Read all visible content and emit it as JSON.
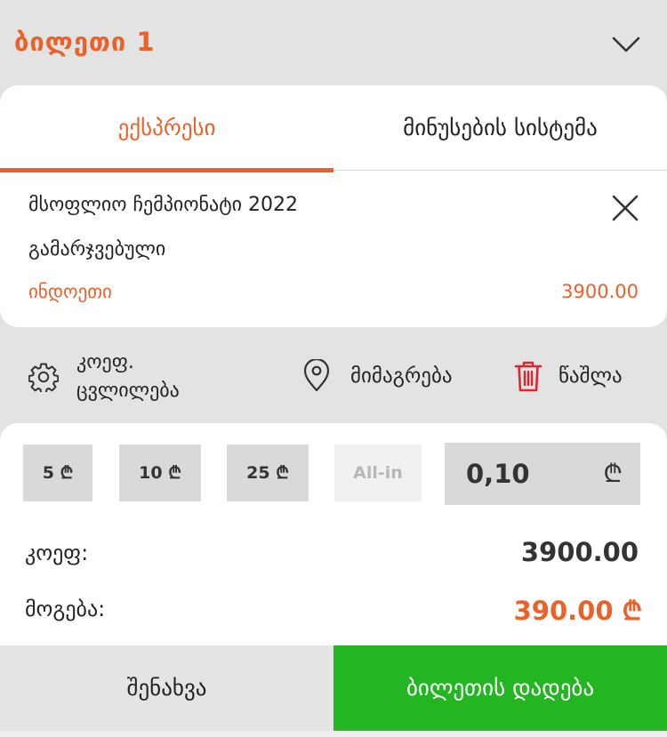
{
  "header": {
    "title": "ბილეთი 1"
  },
  "tabs": [
    {
      "label": "ექსპრესი",
      "active": true
    },
    {
      "label": "მინუსების სისტემა",
      "active": false
    }
  ],
  "bet": {
    "event": "მსოფლიო ჩემპიონატი 2022",
    "market": "გამარჯვებული",
    "selection": "ინდოეთი",
    "odds": "3900.00"
  },
  "actions": {
    "settings_line1": "კოეფ.",
    "settings_line2": "ცვლილება",
    "share": "მიმაგრება",
    "delete": "წაშლა"
  },
  "stake": {
    "chips": [
      "5 ₾",
      "10 ₾",
      "25 ₾",
      "All-in"
    ],
    "value": "0,10",
    "currency": "₾"
  },
  "summary": {
    "odds_label": "კოეფ:",
    "odds_value": "3900.00",
    "win_label": "მოგება:",
    "win_value": "390.00 ₾"
  },
  "buttons": {
    "save": "შენახვა",
    "place": "ბილეთის დადება"
  },
  "colors": {
    "accent": "#e8622a",
    "green": "#24b523",
    "delete_red": "#e0262d"
  }
}
